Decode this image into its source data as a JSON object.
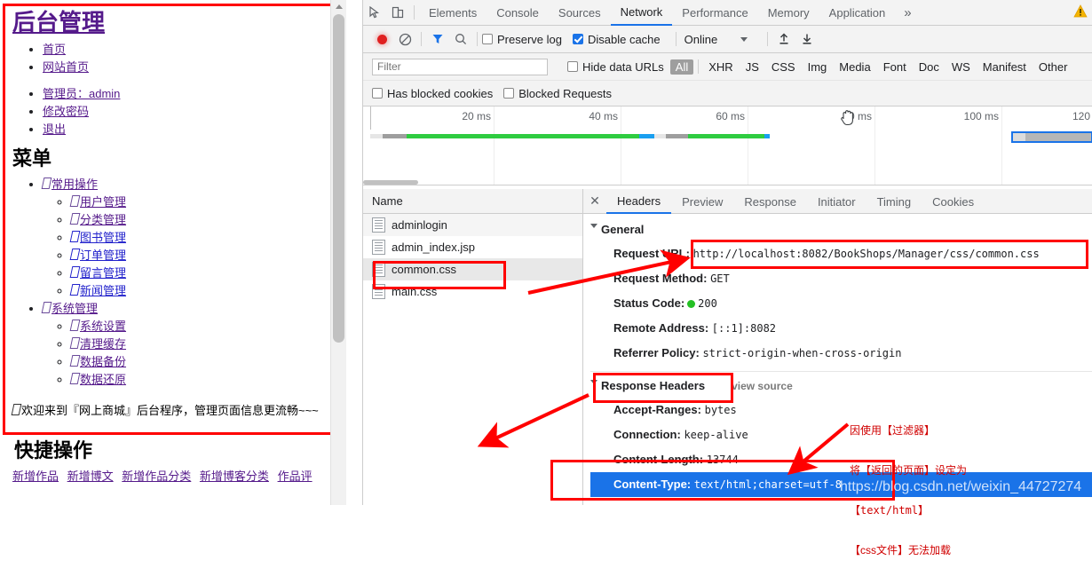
{
  "webpage": {
    "title": "后台管理",
    "top_links": [
      "首页",
      "网站首页"
    ],
    "account_links": [
      "管理员：admin",
      "修改密码",
      "退出"
    ],
    "menu_heading": "菜单",
    "menu": [
      {
        "label": "常用操作",
        "children": [
          "用户管理",
          "分类管理",
          "图书管理",
          "订单管理",
          "留言管理",
          "新闻管理"
        ]
      },
      {
        "label": "系统管理",
        "children": [
          "系统设置",
          "清理缓存",
          "数据备份",
          "数据还原"
        ]
      }
    ],
    "welcome": "欢迎来到『网上商城』后台程序，管理页面信息更流畅~~~",
    "quick_heading": "快捷操作",
    "quick_links": [
      "新增作品",
      "新增博文",
      "新增作品分类",
      "新增博客分类",
      "作品评"
    ]
  },
  "devtools": {
    "panels": [
      "Elements",
      "Console",
      "Sources",
      "Network",
      "Performance",
      "Memory",
      "Application"
    ],
    "active_panel": "Network",
    "more_label": "»",
    "toolbar": {
      "preserve_log_label": "Preserve log",
      "preserve_log_checked": "false",
      "disable_cache_label": "Disable cache",
      "disable_cache_checked": "true",
      "throttling_value": "Online"
    },
    "filterbar": {
      "filter_placeholder": "Filter",
      "hide_data_urls_label": "Hide data URLs",
      "types": [
        "All",
        "XHR",
        "JS",
        "CSS",
        "Img",
        "Media",
        "Font",
        "Doc",
        "WS",
        "Manifest",
        "Other"
      ],
      "selected_type": "All",
      "has_blocked_cookies_label": "Has blocked cookies",
      "blocked_requests_label": "Blocked Requests"
    },
    "timeline": {
      "ticks": [
        "20 ms",
        "40 ms",
        "60 ms",
        "80 ms",
        "100 ms",
        "120"
      ]
    },
    "requests": {
      "column_header": "Name",
      "rows": [
        "adminlogin",
        "admin_index.jsp",
        "common.css",
        "main.css"
      ],
      "selected": "common.css"
    },
    "details": {
      "tabs": [
        "Headers",
        "Preview",
        "Response",
        "Initiator",
        "Timing",
        "Cookies"
      ],
      "active_tab": "Headers",
      "general_section": "General",
      "general": [
        {
          "key": "Request URL:",
          "value": "http://localhost:8082/BookShops/Manager/css/common.css"
        },
        {
          "key": "Request Method:",
          "value": "GET"
        },
        {
          "key": "Status Code:",
          "value": "200"
        },
        {
          "key": "Remote Address:",
          "value": "[::1]:8082"
        },
        {
          "key": "Referrer Policy:",
          "value": "strict-origin-when-cross-origin"
        }
      ],
      "response_section": "Response Headers",
      "view_source": "view source",
      "response_headers": [
        {
          "key": "Accept-Ranges:",
          "value": "bytes"
        },
        {
          "key": "Connection:",
          "value": "keep-alive"
        },
        {
          "key": "Content-Length:",
          "value": "13744"
        },
        {
          "key": "Content-Type:",
          "value": "text/html;charset=utf-8"
        }
      ]
    }
  },
  "annotation": {
    "note_lines": [
      "因使用【过滤器】",
      "将【返回的页面】设定为",
      "【text/html】",
      "【css文件】无法加载"
    ]
  },
  "watermark": "https://blog.csdn.net/weixin_44727274"
}
